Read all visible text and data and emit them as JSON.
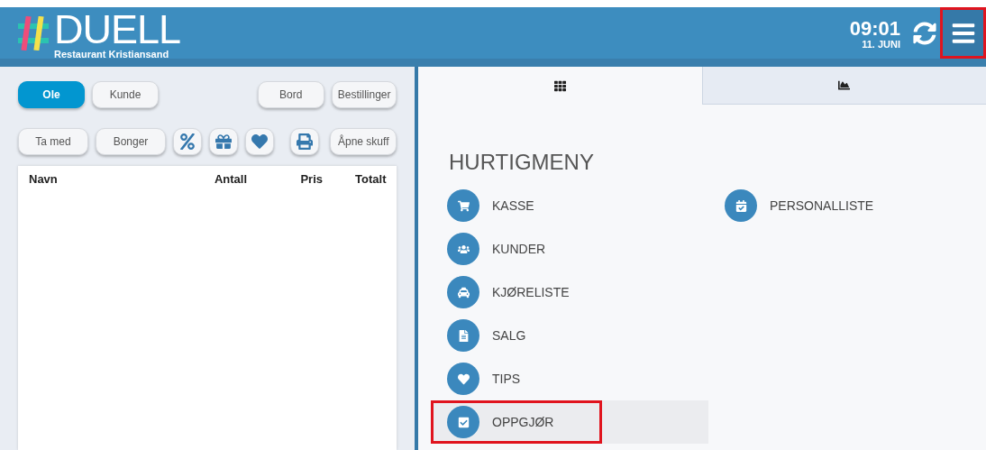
{
  "header": {
    "logo": "DUELL",
    "subtitle": "Restaurant Kristiansand",
    "time": "09:01",
    "date": "11. JUNI",
    "menu_button": {
      "highlighted": true
    }
  },
  "toolbar_row_1": [
    {
      "label": "Ole",
      "selected": true
    },
    {
      "label": "Kunde",
      "selected": false
    },
    {
      "label": "Bord",
      "selected": false
    },
    {
      "label": "Bestillinger",
      "selected": false
    }
  ],
  "toolbar_row_2": [
    {
      "kind": "text",
      "label": "Ta med"
    },
    {
      "kind": "text",
      "label": "Bonger"
    },
    {
      "kind": "icon"
    },
    {
      "kind": "icon"
    },
    {
      "kind": "icon"
    },
    {
      "kind": "icon"
    },
    {
      "kind": "text",
      "label": "Åpne skuff"
    }
  ],
  "order_table": {
    "columns": [
      "Navn",
      "Antall",
      "Pris",
      "Totalt"
    ]
  },
  "tabs": [
    {
      "selected": true
    },
    {
      "selected": false
    }
  ],
  "quick_menu": {
    "title": "HURTIGMENY",
    "column_1": [
      {
        "label": "KASSE",
        "selected": false,
        "highlighted": false
      },
      {
        "label": "KUNDER",
        "selected": false,
        "highlighted": false
      },
      {
        "label": "KJØRELISTE",
        "selected": false,
        "highlighted": false
      },
      {
        "label": "SALG",
        "selected": false,
        "highlighted": false
      },
      {
        "label": "TIPS",
        "selected": false,
        "highlighted": false
      },
      {
        "label": "OPPGJØR",
        "selected": true,
        "highlighted": true
      }
    ],
    "column_2": [
      {
        "label": "PERSONALLISTE",
        "selected": false,
        "highlighted": false
      }
    ]
  }
}
